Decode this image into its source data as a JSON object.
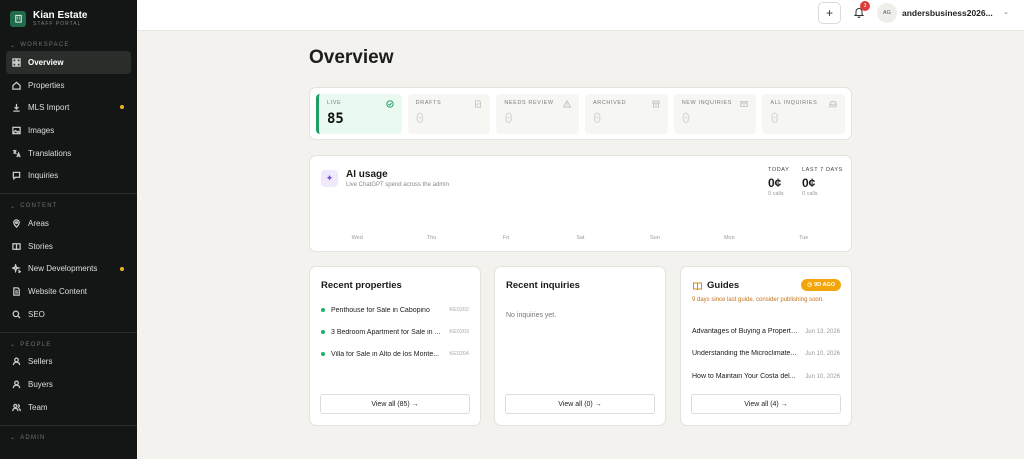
{
  "brand": {
    "name": "Kian Estate",
    "tagline": "STAFF PORTAL"
  },
  "sidebar": {
    "sections": [
      {
        "label": "WORKSPACE",
        "items": [
          {
            "label": "Overview",
            "icon": "grid-icon",
            "active": true
          },
          {
            "label": "Properties",
            "icon": "home-icon"
          },
          {
            "label": "MLS Import",
            "icon": "download-icon",
            "dot": true
          },
          {
            "label": "Images",
            "icon": "image-icon"
          },
          {
            "label": "Translations",
            "icon": "translate-icon"
          },
          {
            "label": "Inquiries",
            "icon": "chat-icon"
          }
        ]
      },
      {
        "label": "CONTENT",
        "items": [
          {
            "label": "Areas",
            "icon": "pin-icon"
          },
          {
            "label": "Stories",
            "icon": "book-icon"
          },
          {
            "label": "New Developments",
            "icon": "sparkle-icon",
            "dot": true
          },
          {
            "label": "Website Content",
            "icon": "file-icon"
          },
          {
            "label": "SEO",
            "icon": "search-icon"
          }
        ]
      },
      {
        "label": "PEOPLE",
        "items": [
          {
            "label": "Sellers",
            "icon": "user-icon"
          },
          {
            "label": "Buyers",
            "icon": "user-icon"
          },
          {
            "label": "Team",
            "icon": "users-icon"
          }
        ]
      },
      {
        "label": "ADMIN",
        "items": []
      }
    ]
  },
  "topbar": {
    "notifications": "3",
    "avatar": "AG",
    "user": "andersbusiness2026..."
  },
  "page": {
    "title": "Overview"
  },
  "stats": [
    {
      "label": "LIVE",
      "value": "85",
      "icon": "check-circle-icon"
    },
    {
      "label": "DRAFTS",
      "value": "0",
      "icon": "draft-icon"
    },
    {
      "label": "NEEDS REVIEW",
      "value": "0",
      "icon": "warning-icon"
    },
    {
      "label": "ARCHIVED",
      "value": "0",
      "icon": "archive-icon"
    },
    {
      "label": "NEW INQUIRIES",
      "value": "0",
      "icon": "mail-icon"
    },
    {
      "label": "ALL INQUIRIES",
      "value": "0",
      "icon": "inbox-icon"
    }
  ],
  "ai": {
    "title": "AI usage",
    "subtitle": "Live ChatGPT spend across the admin",
    "today": {
      "label": "TODAY",
      "value": "0¢",
      "calls": "0 calls"
    },
    "last7": {
      "label": "LAST 7 DAYS",
      "value": "0¢",
      "calls": "0 calls"
    },
    "days": [
      "Wed",
      "Thu",
      "Fri",
      "Sat",
      "Sun",
      "Mon",
      "Tue"
    ]
  },
  "recent_properties": {
    "title": "Recent properties",
    "items": [
      {
        "name": "Penthouse for Sale in Cabopino",
        "id": "KE0202"
      },
      {
        "name": "3 Bedroom Apartment for Sale in ...",
        "id": "KE0203"
      },
      {
        "name": "Villa for Sale in Alto de los Monte...",
        "id": "KE0204"
      }
    ],
    "view_all": "View all (85) →"
  },
  "recent_inquiries": {
    "title": "Recent inquiries",
    "empty": "No inquiries yet.",
    "view_all": "View all (0) →"
  },
  "guides": {
    "title": "Guides",
    "badge": "9D AGO",
    "warning": "9 days since last guide, consider publishing soon.",
    "items": [
      {
        "name": "Advantages of Buying a Property...",
        "date": "Jun 13, 2026"
      },
      {
        "name": "Understanding the Microclimate...",
        "date": "Jun 10, 2026"
      },
      {
        "name": "How to Maintain Your Costa del...",
        "date": "Jun 10, 2026"
      }
    ],
    "view_all": "View all (4) →"
  }
}
